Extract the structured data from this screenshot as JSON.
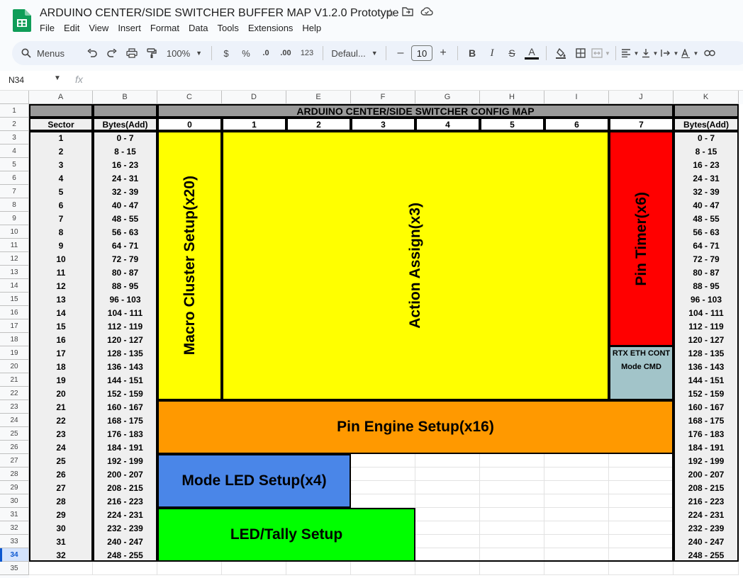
{
  "app": {
    "doc_title": "ARDUINO CENTER/SIDE SWITCHER BUFFER MAP V1.2.0 Prototype",
    "title_icons": [
      "star-icon",
      "move-to-folder-icon",
      "cloud-status-icon"
    ],
    "menu": [
      "File",
      "Edit",
      "View",
      "Insert",
      "Format",
      "Data",
      "Tools",
      "Extensions",
      "Help"
    ]
  },
  "toolbar": {
    "search_label": "Menus",
    "zoom": "100%",
    "currency": "$",
    "percent": "%",
    "dec_decrease": ".0",
    "dec_increase": ".00",
    "number_format": "123",
    "font": "Defaul...",
    "font_size": "10",
    "minus": "–",
    "plus": "+",
    "bold": "B",
    "italic": "I",
    "strike": "S",
    "text_color": "A",
    "text_color_bar": "#000000"
  },
  "formula": {
    "name_box": "N34",
    "fx": "fx",
    "value": ""
  },
  "sheet": {
    "column_headers": [
      "A",
      "B",
      "C",
      "D",
      "E",
      "F",
      "G",
      "H",
      "I",
      "J",
      "K"
    ],
    "selected_row": "34",
    "header_title": "ARDUINO CENTER/SIDE SWITCHER CONFIG MAP",
    "col_sector": "Sector",
    "col_bytes": "Bytes(Add)",
    "col_bytes_right": "Bytes(Add)",
    "byte_columns": [
      "0",
      "1",
      "2",
      "3",
      "4",
      "5",
      "6",
      "7"
    ],
    "sectors": [
      "1",
      "2",
      "3",
      "4",
      "5",
      "6",
      "7",
      "8",
      "9",
      "10",
      "11",
      "12",
      "13",
      "14",
      "15",
      "16",
      "17",
      "18",
      "19",
      "20",
      "21",
      "22",
      "23",
      "24",
      "25",
      "26",
      "27",
      "28",
      "29",
      "30",
      "31",
      "32"
    ],
    "bytes": [
      "0 - 7",
      "8 - 15",
      "16 - 23",
      "24 - 31",
      "32 - 39",
      "40 - 47",
      "48 - 55",
      "56 - 63",
      "64 - 71",
      "72 - 79",
      "80 - 87",
      "88 - 95",
      "96 - 103",
      "104 - 111",
      "112 - 119",
      "120 - 127",
      "128 - 135",
      "136 - 143",
      "144 - 151",
      "152 - 159",
      "160 - 167",
      "168 - 175",
      "176 - 183",
      "184 - 191",
      "192 - 199",
      "200 - 207",
      "208 - 215",
      "216 - 223",
      "224 - 231",
      "232 - 239",
      "240 - 247",
      "248 - 255"
    ],
    "blocks": {
      "macro_cluster": "Macro Cluster Setup(x20)",
      "action_assign": "Action Assign(x3)",
      "pin_timer": "Pin Timer(x6)",
      "rtx_line1": "RTX ETH CONT",
      "rtx_line2": "Mode CMD",
      "pin_engine": "Pin Engine Setup(x16)",
      "mode_led": "Mode LED Setup(x4)",
      "led_tally": "LED/Tally Setup"
    },
    "colors": {
      "header_gray": "#999999",
      "label_gray": "#efefef",
      "yellow": "#ffff00",
      "red": "#ff0000",
      "teal": "#a2c4c9",
      "orange": "#ff9900",
      "blue": "#4a86e8",
      "green": "#00ff00"
    }
  }
}
